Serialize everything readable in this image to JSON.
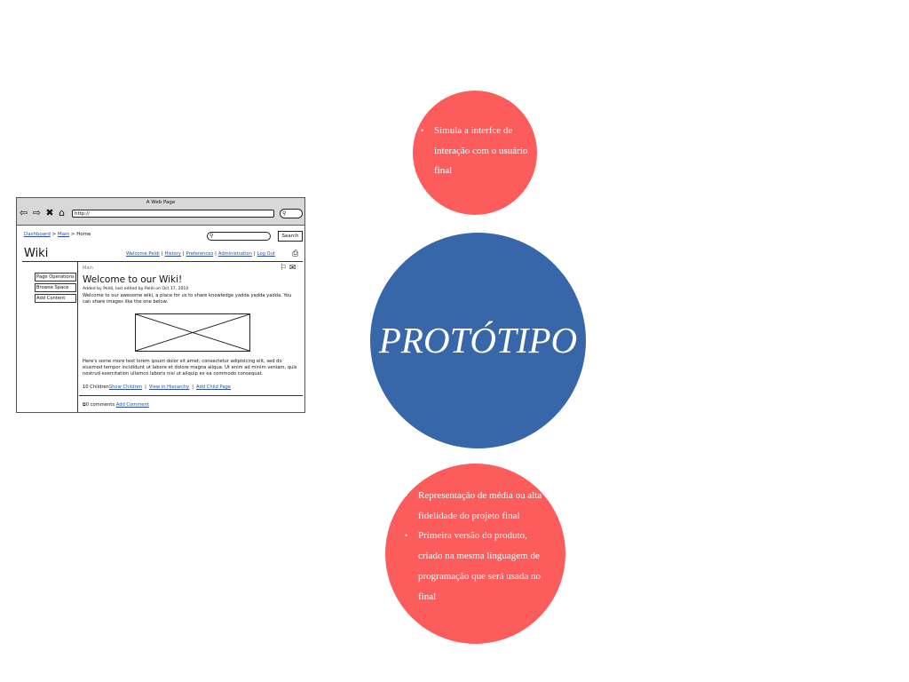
{
  "wireframe": {
    "window_title": "A Web Page",
    "url": "http://",
    "nav_icons": "⇦ ⇨ ✖ ⌂",
    "breadcrumb": {
      "dashboard": "Dashboard",
      "sep1": " > ",
      "main": "Main",
      "sep2": " > ",
      "home": "Home"
    },
    "search_button": "Search",
    "site_title": "Wiki",
    "user_links": [
      "Welcome Peldi",
      "History",
      "Preferences",
      "Administration",
      "Log Out"
    ],
    "sidebar_buttons": [
      "Page Operations",
      "Browse Space",
      "Add Content"
    ],
    "section_label": "Main",
    "page_heading": "Welcome to our Wiki!",
    "meta": "Added by Peldi, last edited by Peldi on Oct 17, 2010",
    "intro_text": "Welcome to our awesome wiki, a place for us to share knowledge yadda yadda yadda. You can share images like the one below.",
    "body_text": "Here's some more text lorem ipsum dolor sit amet, consectetur adipisicing elit, sed do eiusmod tempor incididunt ut labore et dolore magna aliqua. Ut enim ad minim veniam, quis nostrud exercitation ullamco laboris nisi ut aliquip ex ea commodo consequat.",
    "children_label": "10 Children",
    "children_links": [
      "Show Children",
      "View in Hierarchy",
      "Add Child Page"
    ],
    "comments_label": "0 comments",
    "add_comment": "Add Comment"
  },
  "diagram": {
    "top_bullets": [
      "Simula a interfce de interação com o usuário final"
    ],
    "center_title": "PROTÓTIPO",
    "bottom_bullets": [
      "Representação de média ou alta fidelidade do projeto final",
      "Primeira versão do produto, criado na mesma linguagem de programação que será usada no final"
    ],
    "colors": {
      "red_circle": "#fd5c5c",
      "blue_circle": "#3767a8",
      "text": "#ffffff"
    }
  }
}
